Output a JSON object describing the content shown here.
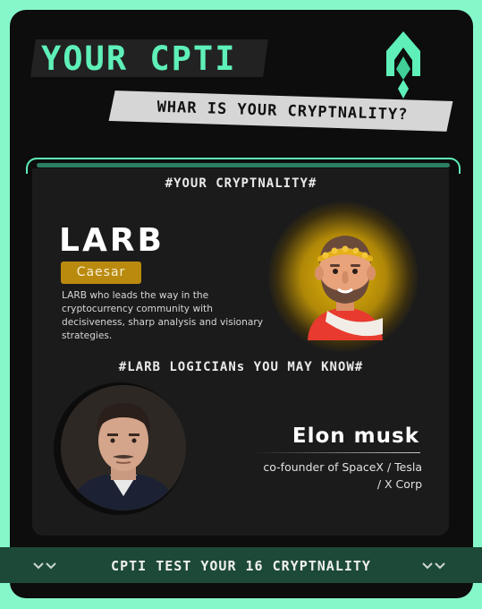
{
  "header": {
    "title": "YOUR CPTI",
    "subtitle": "WHAR IS YOUR CRYPTNALITY?",
    "logo_icon": "rocket-logo-icon"
  },
  "result": {
    "section_title": "#YOUR CRYPTNALITY#",
    "type_code": "LARB",
    "type_name": "Caesar",
    "description": "LARB who leads the way in the cryptocurrency community with decisiveness, sharp analysis and visionary strategies.",
    "avatar_icon": "caesar-avatar-icon"
  },
  "people": {
    "section_title": "#LARB LOGICIANs YOU MAY KNOW#",
    "name": "Elon musk",
    "role_line1": "co-founder of SpaceX / Tesla",
    "role_line2": "/ X Corp"
  },
  "footer": {
    "cta_label": "CPTI TEST YOUR 16 CRYPTNALITY",
    "left_icon": "double-chevron-down-icon",
    "right_icon": "double-chevron-down-icon"
  },
  "colors": {
    "accent": "#5ef0b8",
    "background": "#0d0d0d",
    "outer": "#86f7c9",
    "badge": "#b98a0e",
    "footer": "#1d4a38"
  }
}
